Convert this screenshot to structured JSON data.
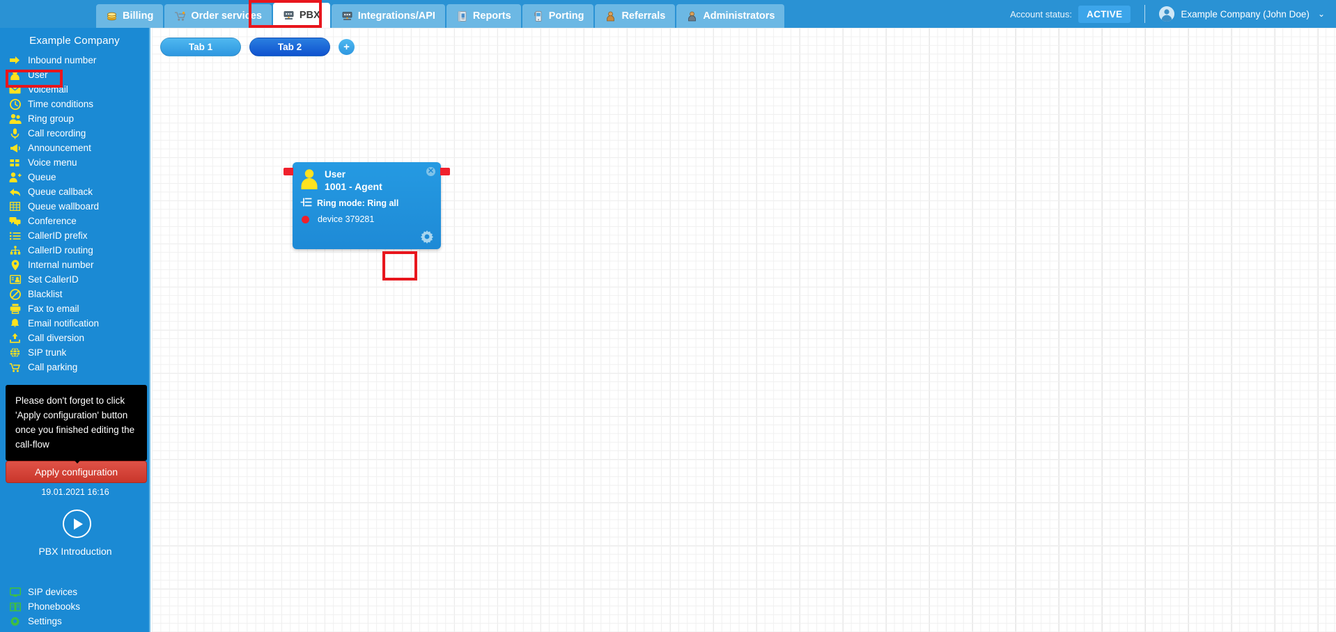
{
  "topnav": {
    "tabs": [
      {
        "label": "Billing",
        "icon": "coins-icon",
        "active": false
      },
      {
        "label": "Order services",
        "icon": "shopping-cart-icon",
        "active": false
      },
      {
        "label": "PBX",
        "icon": "pbx-server-icon",
        "active": true
      },
      {
        "label": "Integrations/API",
        "icon": "server-rack-icon",
        "active": false
      },
      {
        "label": "Reports",
        "icon": "report-book-icon",
        "active": false
      },
      {
        "label": "Porting",
        "icon": "mobile-phone-icon",
        "active": false
      },
      {
        "label": "Referrals",
        "icon": "person-badge-icon",
        "active": false
      },
      {
        "label": "Administrators",
        "icon": "admin-person-icon",
        "active": false
      }
    ],
    "account_status_label": "Account status:",
    "account_status_value": "ACTIVE",
    "user_name": "Example Company (John Doe)",
    "chevron": "⌄"
  },
  "sidebar": {
    "title": "Example Company",
    "items": [
      {
        "label": "Inbound number",
        "icon": "arrow-in-icon"
      },
      {
        "label": "User",
        "icon": "person-icon"
      },
      {
        "label": "Voicemail",
        "icon": "envelope-icon"
      },
      {
        "label": "Time conditions",
        "icon": "clock-icon"
      },
      {
        "label": "Ring group",
        "icon": "people-group-icon"
      },
      {
        "label": "Call recording",
        "icon": "microphone-icon"
      },
      {
        "label": "Announcement",
        "icon": "megaphone-icon"
      },
      {
        "label": "Voice menu",
        "icon": "grid-squares-icon"
      },
      {
        "label": "Queue",
        "icon": "person-plus-icon"
      },
      {
        "label": "Queue callback",
        "icon": "reply-arrow-icon"
      },
      {
        "label": "Queue wallboard",
        "icon": "table-grid-icon"
      },
      {
        "label": "Conference",
        "icon": "speech-bubbles-icon"
      },
      {
        "label": "CallerID prefix",
        "icon": "list-icon"
      },
      {
        "label": "CallerID routing",
        "icon": "sitemap-icon"
      },
      {
        "label": "Internal number",
        "icon": "map-pin-icon"
      },
      {
        "label": "Set CallerID",
        "icon": "id-card-icon"
      },
      {
        "label": "Blacklist",
        "icon": "no-entry-icon"
      },
      {
        "label": "Fax to email",
        "icon": "fax-icon"
      },
      {
        "label": "Email notification",
        "icon": "bell-icon"
      },
      {
        "label": "Call diversion",
        "icon": "upload-arrow-icon"
      },
      {
        "label": "SIP trunk",
        "icon": "network-globe-icon"
      },
      {
        "label": "Call parking",
        "icon": "shopping-cart-icon"
      }
    ],
    "tooltip": "Please don't forget to click 'Apply configuration' button once you finished editing the call-flow",
    "apply_label": "Apply configuration",
    "apply_timestamp": "19.01.2021 16:16",
    "intro_label": "PBX Introduction",
    "bottom_items": [
      {
        "label": "SIP devices",
        "icon": "monitor-icon"
      },
      {
        "label": "Phonebooks",
        "icon": "open-book-icon"
      },
      {
        "label": "Settings",
        "icon": "gear-icon"
      }
    ]
  },
  "canvas": {
    "tabs": [
      {
        "label": "Tab 1"
      },
      {
        "label": "Tab 2"
      }
    ],
    "add_tab_label": "+",
    "node": {
      "title": "User",
      "subtitle": "1001 - Agent",
      "ring_mode": "Ring mode: Ring all",
      "device": "device 379281",
      "close_label": "✕",
      "gear_icon": "gear-icon"
    }
  },
  "colors": {
    "topnav_bg": "#2a92d4",
    "sidebar_bg": "#1b8ad4",
    "highlight_red": "#e8161d",
    "apply_red": "#c9362b",
    "node_blue": "#1e8ad6",
    "icon_yellow": "#ffe21f",
    "icon_green": "#3fbf3f",
    "connector_red": "#f0202c"
  }
}
